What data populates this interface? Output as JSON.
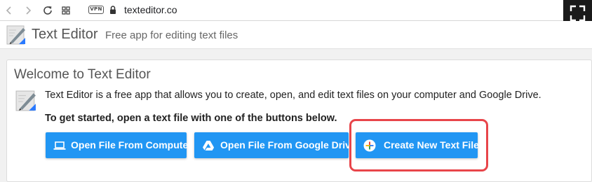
{
  "browser": {
    "back_icon": "back-arrow-icon",
    "forward_icon": "forward-arrow-icon",
    "reload_icon": "reload-icon",
    "extensions_icon": "grid-icon",
    "vpn_label": "VPN",
    "url": "texteditor.co"
  },
  "header": {
    "title": "Text Editor",
    "subtitle": "Free app for editing text files"
  },
  "welcome": {
    "title": "Welcome to Text Editor",
    "description": "Text Editor is a free app that allows you to create, open, and edit text files on your computer and Google Drive.",
    "instruction": "To get started, open a text file with one of the buttons below."
  },
  "buttons": {
    "open_computer": "Open File From Computer",
    "open_drive": "Open File From Google Drive",
    "create_new": "Create New Text File"
  },
  "colors": {
    "button_bg": "#2196f3",
    "highlight": "#e8454a"
  }
}
